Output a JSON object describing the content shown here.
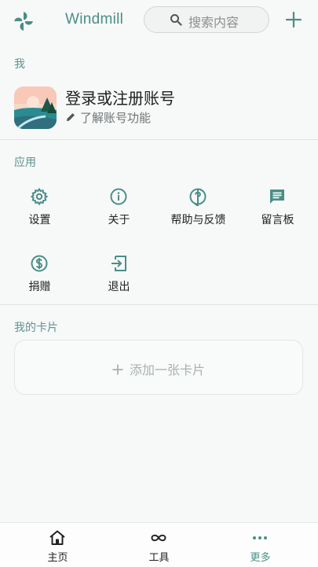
{
  "header": {
    "title": "Windmill",
    "search_placeholder": "搜索内容",
    "logo_icon": "windmill-logo-icon",
    "add_icon": "plus-icon"
  },
  "me": {
    "section_label": "我",
    "login_title": "登录或注册账号",
    "login_subtitle": "了解账号功能"
  },
  "apps": {
    "section_label": "应用",
    "items": [
      {
        "label": "设置",
        "icon": "gear-icon"
      },
      {
        "label": "关于",
        "icon": "info-icon"
      },
      {
        "label": "帮助与反馈",
        "icon": "help-icon"
      },
      {
        "label": "留言板",
        "icon": "message-board-icon"
      },
      {
        "label": "捐赠",
        "icon": "dollar-icon"
      },
      {
        "label": "退出",
        "icon": "exit-icon"
      }
    ]
  },
  "cards": {
    "section_label": "我的卡片",
    "add_label": "添加一张卡片"
  },
  "tabbar": {
    "tabs": [
      {
        "label": "主页",
        "icon": "home-icon"
      },
      {
        "label": "工具",
        "icon": "infinity-icon"
      },
      {
        "label": "更多",
        "icon": "more-dots-icon",
        "active": true
      }
    ]
  },
  "colors": {
    "accent": "#4a8e88",
    "background": "#f7f8f8"
  }
}
